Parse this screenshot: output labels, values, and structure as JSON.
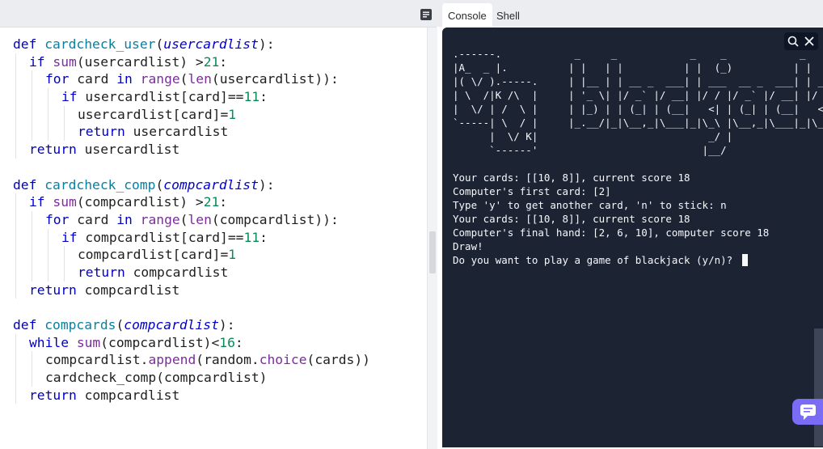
{
  "editor": {
    "icon": "list-icon",
    "lines": [
      [
        {
          "t": "def ",
          "c": "kw"
        },
        {
          "t": "cardcheck_user",
          "c": "fn"
        },
        {
          "t": "(",
          "c": ""
        },
        {
          "t": "usercardlist",
          "c": "it"
        },
        {
          "t": "):",
          "c": ""
        }
      ],
      [
        {
          "t": "if ",
          "c": "kw"
        },
        {
          "t": "sum",
          "c": "bi"
        },
        {
          "t": "(usercardlist) >",
          "c": ""
        },
        {
          "t": "21",
          "c": "num"
        },
        {
          "t": ":",
          "c": ""
        }
      ],
      [
        {
          "t": "for ",
          "c": "kw"
        },
        {
          "t": "card ",
          "c": ""
        },
        {
          "t": "in ",
          "c": "kw"
        },
        {
          "t": "range",
          "c": "bi"
        },
        {
          "t": "(",
          "c": ""
        },
        {
          "t": "len",
          "c": "bi"
        },
        {
          "t": "(usercardlist)):",
          "c": ""
        }
      ],
      [
        {
          "t": "if ",
          "c": "kw"
        },
        {
          "t": "usercardlist[card]==",
          "c": ""
        },
        {
          "t": "11",
          "c": "num"
        },
        {
          "t": ":",
          "c": ""
        }
      ],
      [
        {
          "t": "usercardlist[card]=",
          "c": ""
        },
        {
          "t": "1",
          "c": "num"
        }
      ],
      [
        {
          "t": "return ",
          "c": "kw"
        },
        {
          "t": "usercardlist",
          "c": ""
        }
      ],
      [
        {
          "t": "return ",
          "c": "kw"
        },
        {
          "t": "usercardlist",
          "c": ""
        }
      ],
      [],
      [
        {
          "t": "def ",
          "c": "kw"
        },
        {
          "t": "cardcheck_comp",
          "c": "fn"
        },
        {
          "t": "(",
          "c": ""
        },
        {
          "t": "compcardlist",
          "c": "it"
        },
        {
          "t": "):",
          "c": ""
        }
      ],
      [
        {
          "t": "if ",
          "c": "kw"
        },
        {
          "t": "sum",
          "c": "bi"
        },
        {
          "t": "(compcardlist) >",
          "c": ""
        },
        {
          "t": "21",
          "c": "num"
        },
        {
          "t": ":",
          "c": ""
        }
      ],
      [
        {
          "t": "for ",
          "c": "kw"
        },
        {
          "t": "card ",
          "c": ""
        },
        {
          "t": "in ",
          "c": "kw"
        },
        {
          "t": "range",
          "c": "bi"
        },
        {
          "t": "(",
          "c": ""
        },
        {
          "t": "len",
          "c": "bi"
        },
        {
          "t": "(compcardlist)):",
          "c": ""
        }
      ],
      [
        {
          "t": "if ",
          "c": "kw"
        },
        {
          "t": "compcardlist[card]==",
          "c": ""
        },
        {
          "t": "11",
          "c": "num"
        },
        {
          "t": ":",
          "c": ""
        }
      ],
      [
        {
          "t": "compcardlist[card]=",
          "c": ""
        },
        {
          "t": "1",
          "c": "num"
        }
      ],
      [
        {
          "t": "return ",
          "c": "kw"
        },
        {
          "t": "compcardlist",
          "c": ""
        }
      ],
      [
        {
          "t": "return ",
          "c": "kw"
        },
        {
          "t": "compcardlist",
          "c": ""
        }
      ],
      [],
      [
        {
          "t": "def ",
          "c": "kw"
        },
        {
          "t": "compcards",
          "c": "fn"
        },
        {
          "t": "(",
          "c": ""
        },
        {
          "t": "compcardlist",
          "c": "it"
        },
        {
          "t": "):",
          "c": ""
        }
      ],
      [
        {
          "t": "while ",
          "c": "kw"
        },
        {
          "t": "sum",
          "c": "bi"
        },
        {
          "t": "(compcardlist)<",
          "c": ""
        },
        {
          "t": "16",
          "c": "num"
        },
        {
          "t": ":",
          "c": ""
        }
      ],
      [
        {
          "t": "compcardlist.",
          "c": ""
        },
        {
          "t": "append",
          "c": "bi"
        },
        {
          "t": "(random.",
          "c": ""
        },
        {
          "t": "choice",
          "c": "bi"
        },
        {
          "t": "(cards))",
          "c": ""
        }
      ],
      [
        {
          "t": "cardcheck_comp(compcardlist)",
          "c": ""
        }
      ],
      [
        {
          "t": "return ",
          "c": "kw"
        },
        {
          "t": "compcardlist",
          "c": ""
        }
      ]
    ],
    "indents": [
      0,
      1,
      2,
      3,
      4,
      4,
      1,
      0,
      0,
      1,
      2,
      3,
      4,
      4,
      1,
      0,
      0,
      1,
      2,
      2,
      1
    ]
  },
  "tabs": [
    {
      "label": "Console",
      "active": true
    },
    {
      "label": "Shell",
      "active": false
    }
  ],
  "console": {
    "tool_icons": [
      "search-icon",
      "close-icon"
    ],
    "lines": [
      ".------.            _     _            _    _            _",
      "|A_  _ |.          | |   | |          | |  (_)          | |",
      "|( \\/ ).-----.     | |__ | | __ _  ___| | ___  __ _  ___| | __",
      "| \\  /|K /\\  |     | '_ \\| |/ _` |/ __| |/ / |/ _` |/ __| |/ /",
      "|  \\/ | /  \\ |     | |_) | | (_| | (__|   <| | (_| | (__|   <",
      "`-----| \\  / |     |_.__/|_|\\__,_|\\___|_|\\_\\ |\\__,_|\\___|_|\\_\\",
      "      |  \\/ K|                            _/ |",
      "      `------'                           |__/",
      "",
      "Your cards: [[10, 8]], current score 18",
      "Computer's first card: [2]",
      "Type 'y' to get another card, 'n' to stick: n",
      "Your cards: [[10, 8]], current score 18",
      "Computer's final hand: [2, 6, 10], computer score 18",
      "Draw!",
      "Do you want to play a game of blackjack (y/n)? "
    ],
    "chat_icon": "chat-icon"
  }
}
